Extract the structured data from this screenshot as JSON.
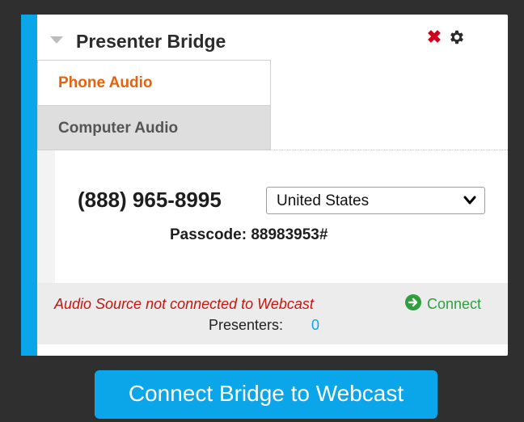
{
  "colors": {
    "accent": "#0aa6e9",
    "tab_active_text": "#e8620c",
    "close": "#d0021b",
    "status_error": "#c4160f",
    "connect": "#2e9e3f",
    "link": "#0aa6e9",
    "gear": "#2b2b2b"
  },
  "panel": {
    "title": "Presenter Bridge",
    "collapse_icon": "triangle-down-icon",
    "close_icon": "close-icon",
    "settings_icon": "gear-icon",
    "close_glyph": "✖"
  },
  "tabs": [
    {
      "label": "Phone Audio",
      "active": true
    },
    {
      "label": "Computer Audio",
      "active": false
    }
  ],
  "phone_audio": {
    "phone_number": "(888) 965-8995",
    "country_selected": "United States",
    "passcode": "Passcode: 88983953#"
  },
  "status": {
    "message": "Audio Source not connected to Webcast",
    "connect_label": "Connect",
    "connect_icon": "arrow-circle-right-icon",
    "presenters_label": "Presenters:",
    "presenters_count": "0"
  },
  "footer": {
    "button_label": "Connect Bridge to Webcast"
  }
}
